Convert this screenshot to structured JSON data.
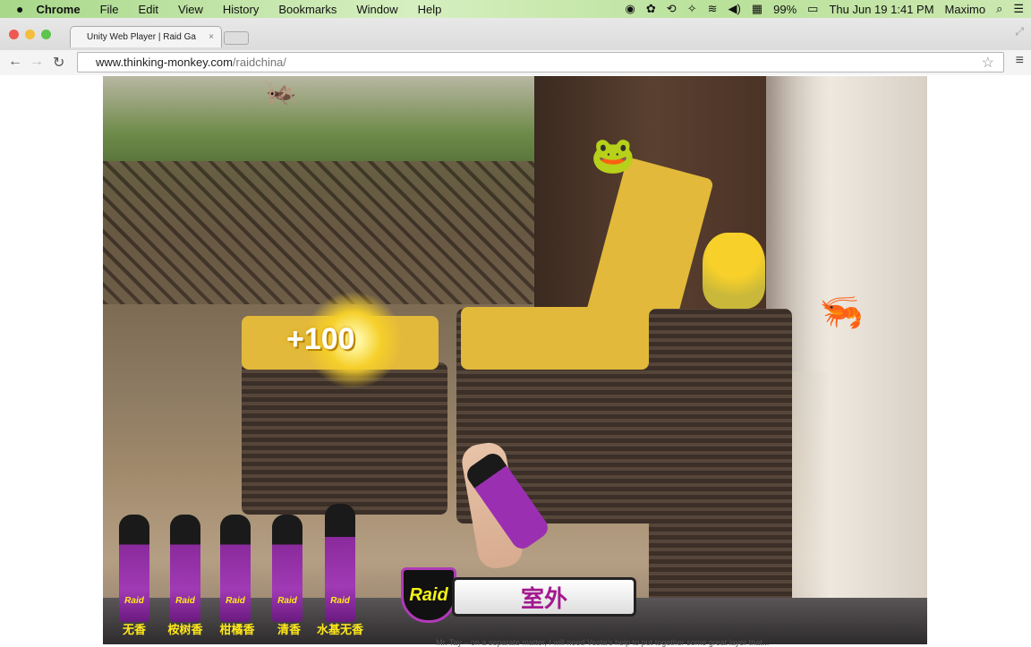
{
  "menubar": {
    "apple": "",
    "app": "Chrome",
    "items": [
      "File",
      "Edit",
      "View",
      "History",
      "Bookmarks",
      "Window",
      "Help"
    ],
    "battery": "99%",
    "datetime": "Thu Jun 19  1:41 PM",
    "user": "Maximo"
  },
  "browser": {
    "tab_title": "Unity Web Player | Raid Ga",
    "tab_close": "×",
    "url_host": "www.thinking-monkey.com",
    "url_path": "/raidchina/"
  },
  "game": {
    "score_popup": "+100",
    "outdoor_button": "室外",
    "logo": "Raid",
    "products": [
      {
        "label": "无香"
      },
      {
        "label": "桉树香"
      },
      {
        "label": "柑橘香"
      },
      {
        "label": "清香"
      },
      {
        "label": "水基无香"
      }
    ],
    "can_brand": "Raid"
  },
  "page": {
    "below_text": "Mr. Tay – on a separate matter, I will need Vesta's help to put together some great layer that..."
  }
}
